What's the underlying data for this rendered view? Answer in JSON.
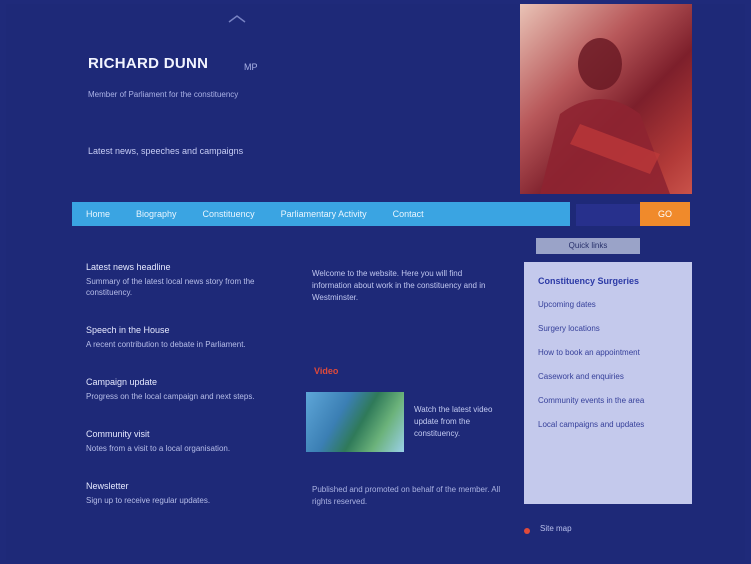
{
  "site": {
    "title": "RICHARD DUNN",
    "title_suffix": "MP",
    "tagline": "Member of Parliament for the constituency",
    "intro": "Latest news, speeches and campaigns",
    "hero_alt": "Portrait photo"
  },
  "nav": {
    "items": [
      "Home",
      "Biography",
      "Constituency",
      "Parliamentary Activity",
      "Contact"
    ],
    "search_placeholder": "",
    "go_label": "GO"
  },
  "sidebar": {
    "tab_label": "Quick links",
    "title": "Constituency Surgeries",
    "items": [
      "Upcoming dates",
      "Surgery locations",
      "How to book an appointment",
      "Casework and enquiries",
      "Community events in the area",
      "Local campaigns and updates"
    ]
  },
  "left_blocks": [
    {
      "head": "Latest news headline",
      "body": "Summary of the latest local news story from the constituency."
    },
    {
      "head": "Speech in the House",
      "body": "A recent contribution to debate in Parliament."
    },
    {
      "head": "Campaign update",
      "body": "Progress on the local campaign and next steps."
    },
    {
      "head": "Community visit",
      "body": "Notes from a visit to a local organisation."
    },
    {
      "head": "Newsletter",
      "body": "Sign up to receive regular updates."
    }
  ],
  "middle": {
    "intro": "Welcome to the website. Here you will find information about work in the constituency and in Westminster.",
    "video_label": "Video",
    "video_caption": "Watch the latest video update from the constituency.",
    "footer": "Published and promoted on behalf of the member. All rights reserved."
  },
  "footer": {
    "link": "Site map"
  }
}
